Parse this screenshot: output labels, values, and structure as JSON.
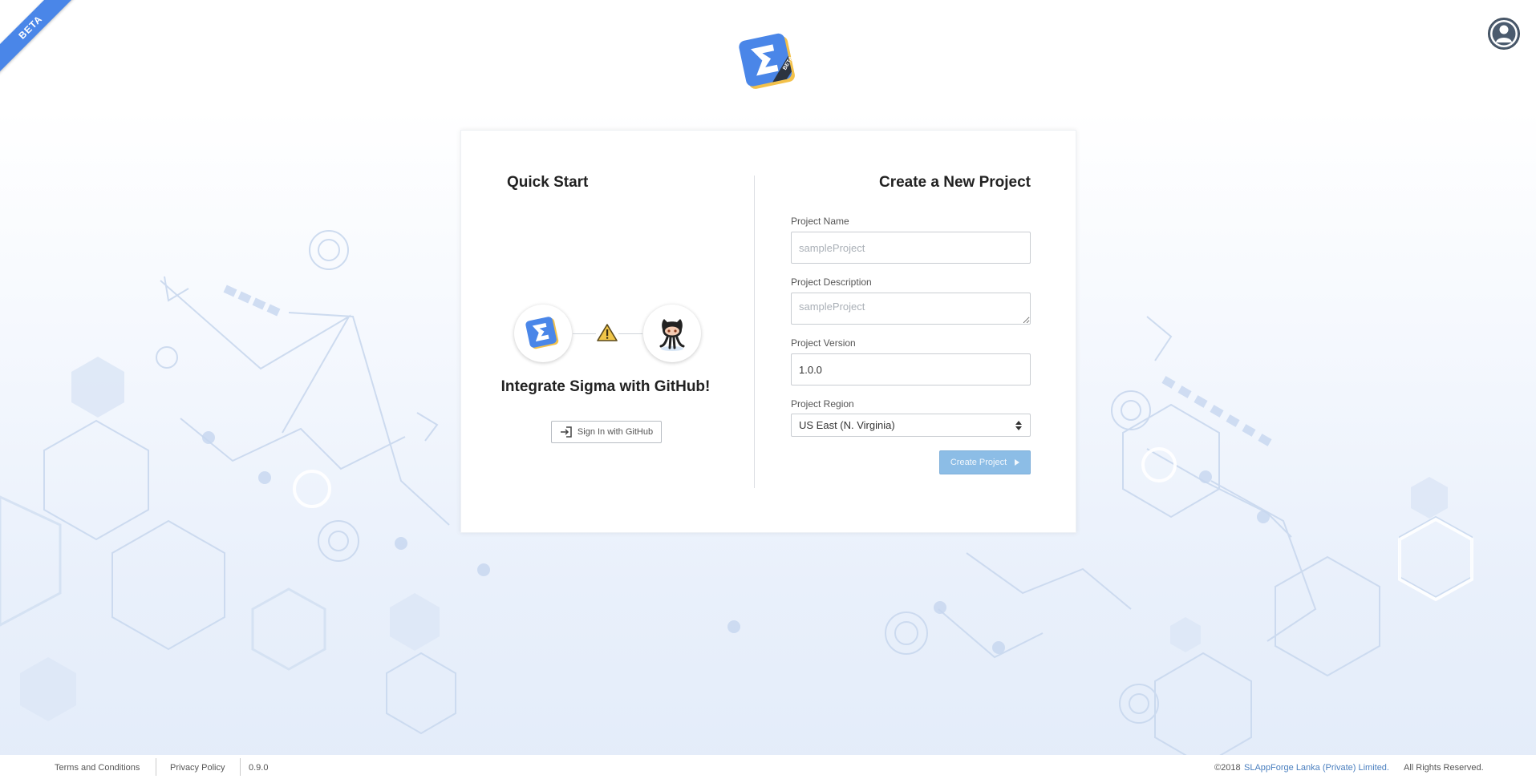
{
  "ribbon": {
    "label": "BETA"
  },
  "quick_start": {
    "title": "Quick Start",
    "integration_title": "Integrate Sigma with GitHub!",
    "signin_label": "Sign In with GitHub"
  },
  "create_project": {
    "title": "Create a New Project",
    "name": {
      "label": "Project Name",
      "placeholder": "sampleProject",
      "value": ""
    },
    "description": {
      "label": "Project Description",
      "placeholder": "sampleProject",
      "value": ""
    },
    "version": {
      "label": "Project Version",
      "value": "1.0.0"
    },
    "region": {
      "label": "Project Region",
      "selected": "US East (N. Virginia)"
    },
    "submit_label": "Create Project"
  },
  "footer": {
    "terms": "Terms and Conditions",
    "privacy": "Privacy Policy",
    "version": "0.9.0",
    "copyright_prefix": "©2018",
    "company": "SLAppForge Lanka (Private) Limited.",
    "rights": "All Rights Reserved."
  },
  "colors": {
    "brand_blue": "#4a86e8",
    "button_disabled": "#8cbde6",
    "logo_gold": "#f3c14a",
    "logo_dark": "#2c3440"
  },
  "icons": {
    "logo": "sigma-logo-icon",
    "avatar": "user-avatar-icon",
    "warning": "warning-icon",
    "github": "github-octocat-icon",
    "signin": "sign-in-icon",
    "select_arrows": "sort-arrows-icon",
    "submit_caret": "caret-right-icon"
  }
}
